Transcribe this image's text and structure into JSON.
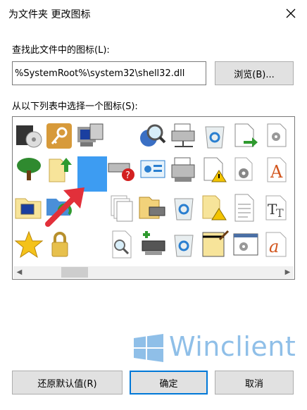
{
  "window": {
    "title": "为文件夹  更改图标"
  },
  "file_label": "查找此文件中的图标(L):",
  "file_path": "%SystemRoot%\\system32\\shell32.dll",
  "browse_label": "浏览(B)...",
  "list_label": "从以下列表中选择一个图标(S):",
  "icons": {
    "row1": [
      "cd-drive-icon",
      "key-icon",
      "network-computer-icon",
      "blank",
      "search-globe-icon",
      "printer-network-icon",
      "recycle-bin-icon",
      "document-arrow-icon",
      "gear-document-icon"
    ],
    "row2": [
      "tree-icon",
      "folder-up-arrow-icon",
      "selected-icon",
      "drive-error-icon",
      "control-panel-icon",
      "fax-printer-icon",
      "document-warning-icon",
      "gear-icon",
      "font-a-icon"
    ],
    "row3": [
      "folder-computer-icon",
      "folder-sync-icon",
      "blank",
      "documents-stack-icon",
      "folder-printer-icon",
      "recycle-bin-full-icon",
      "folder-warning-icon",
      "text-document-icon",
      "font-tt-icon"
    ],
    "row4": [
      "star-icon",
      "lock-icon",
      "blank",
      "document-search-icon",
      "printer-add-icon",
      "recycle-bin-empty-icon",
      "notepad-icon",
      "settings-window-icon",
      "font-a-italic-icon"
    ]
  },
  "buttons": {
    "restore": "还原默认值(R)",
    "ok": "确定",
    "cancel": "取消"
  },
  "watermark": {
    "text": "Winclient",
    "color": "#8fbfe8"
  }
}
